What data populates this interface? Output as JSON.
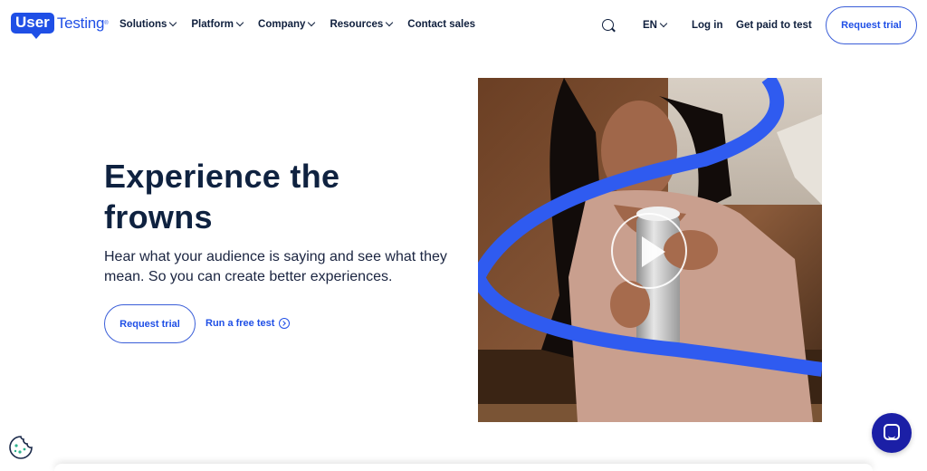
{
  "header": {
    "logo_user": "User",
    "logo_testing": "Testing",
    "logo_tm": "®",
    "nav": [
      {
        "label": "Solutions",
        "has_dropdown": true
      },
      {
        "label": "Platform",
        "has_dropdown": true
      },
      {
        "label": "Company",
        "has_dropdown": true
      },
      {
        "label": "Resources",
        "has_dropdown": true
      },
      {
        "label": "Contact sales",
        "has_dropdown": false
      }
    ],
    "search_icon": "search-icon",
    "language": "EN",
    "login": "Log in",
    "get_paid": "Get paid to test",
    "request_trial": "Request trial"
  },
  "hero": {
    "title": "Experience the frowns",
    "subtitle": "Hear what your audience is saying and see what they mean. So you can create better experiences.",
    "request_trial": "Request trial",
    "free_test": "Run a free test"
  },
  "media": {
    "play_icon": "play-icon"
  },
  "widgets": {
    "cookie_icon": "cookie-icon",
    "chat_icon": "chat-icon"
  },
  "colors": {
    "brand": "#1f4fe6",
    "heading": "#0f2240",
    "chat": "#1b1fa6"
  }
}
